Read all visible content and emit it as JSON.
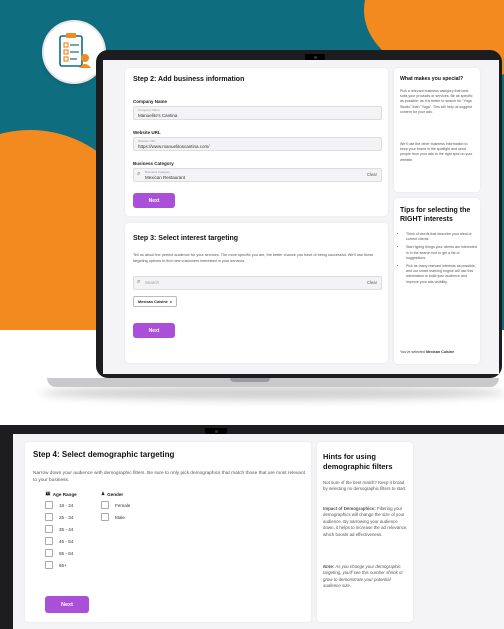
{
  "colors": {
    "teal": "#0f6d80",
    "orange": "#f28a20",
    "purple": "#a94fd8"
  },
  "logo": {
    "icon": "checklist-icon"
  },
  "step2": {
    "title": "Step 2: Add business information",
    "company_label": "Company Name",
    "company_tiny": "Company Name",
    "company_value": "Manuelito's Cantina",
    "website_label": "Website URL",
    "website_tiny": "Website URL",
    "website_value": "https://www.manuelitoscantina.com/",
    "category_label": "Business Category",
    "category_tiny": "Business Category",
    "category_value": "Mexican Restaurant",
    "clear": "Clear",
    "next": "Next"
  },
  "special": {
    "title": "What makes you special?",
    "p1": "Pick a relevant business category that best suits your products or services. Be as specific as possible, as it is better to search for \"Yoga Studio\" than \"Yoga\". This will help us suggest content for your ads.",
    "p2": "We'll use the other business information to keep your brand in the spotlight and send people from your ads to the right spot on your website."
  },
  "step3": {
    "title": "Step 3: Select interest targeting",
    "desc": "Tell us about the perfect audience for your services. The more specific you are, the better chance you have of being successful. We'll use these targeting options to find new customers interested in your services.",
    "search_placeholder": "Search",
    "clear": "Clear",
    "chip": "Mexican Cuisine",
    "next": "Next"
  },
  "tips": {
    "title": "Tips for selecting the RIGHT interests",
    "items": [
      "Think of words that describe your ideal or current clients",
      "Start typing things your clients are interested in in the search box to get a list of suggestions.",
      "Pick as many relevant interests as possible, and our smart learning engine will use this information to build your audience and improve your ads visibility."
    ],
    "selected_prefix": "You've selected ",
    "selected_value": "Mexican Cuisine"
  },
  "step4": {
    "title": "Step 4: Select demographic targeting",
    "desc": "Narrow down your audience with demographic filters. Be sure to only pick demographics that match those that are most relevant to your business.",
    "age_header": "Age Range",
    "gender_header": "Gender",
    "ages": [
      "18 - 24",
      "25 - 34",
      "35 - 44",
      "45 - 54",
      "55 - 64",
      "65+"
    ],
    "genders": [
      "Female",
      "Male"
    ],
    "next": "Next"
  },
  "hints": {
    "title": "Hints for using demographic filters",
    "p1": "Not sure of the best match? Keep it broad by selecting no demographic filters to start.",
    "p2_bold": "Impact of Demographics:",
    "p2": " Filtering your demographics will change the size of your audience. By narrowing your audience down, it helps to increase the ad relevance, which boosts ad effectiveness.",
    "p3_bold": "Note:",
    "p3": " As you change your demographic targeting, you'll see this number shrink or grow to demonstrate your potential audience size."
  }
}
